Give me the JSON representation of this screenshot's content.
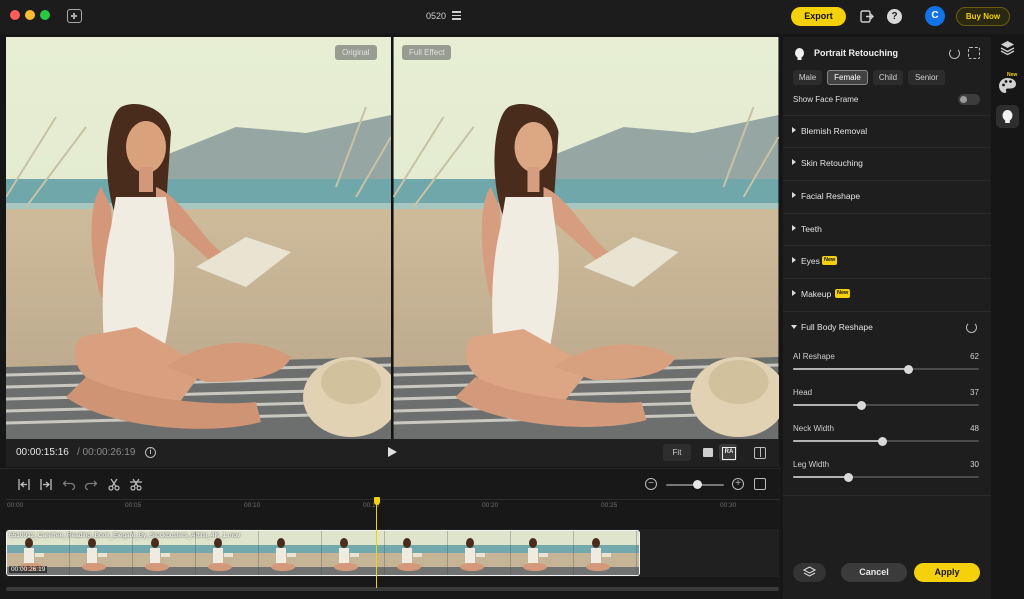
{
  "titlebar": {
    "project_name": "0520",
    "export_label": "Export",
    "avatar_letter": "C",
    "buy_now_label": "Buy Now",
    "help_glyph": "?"
  },
  "preview": {
    "original_label": "Original",
    "full_effect_label": "Full Effect"
  },
  "playback": {
    "current_time": "00:00:15:16",
    "total_time": "/ 00:00:26:19",
    "fit_label": "Fit",
    "info_glyph": "i"
  },
  "timeline": {
    "ruler_ticks": [
      "00:00",
      "00:05",
      "00:10",
      "00:15",
      "00:20",
      "00:25",
      "00:30"
    ],
    "clip_name": "6510912_Carefree_Reading_Book_Elegant_By_Stockbusters_Artlist_4K_1.mov",
    "clip_duration": "00:00:26:19",
    "playhead_time_s": 15.5,
    "zoom_level": 0.5
  },
  "panel": {
    "title": "Portrait Retouching",
    "gender_options": [
      "Male",
      "Female",
      "Child",
      "Senior"
    ],
    "gender_selected": "Female",
    "show_face_frame_label": "Show Face Frame",
    "show_face_frame_on": false,
    "new_badge": "New",
    "sections": [
      {
        "label": "Blemish Removal",
        "new": false,
        "open": false
      },
      {
        "label": "Skin Retouching",
        "new": false,
        "open": false
      },
      {
        "label": "Facial Reshape",
        "new": false,
        "open": false
      },
      {
        "label": "Teeth",
        "new": false,
        "open": false
      },
      {
        "label": "Eyes",
        "new": true,
        "open": false
      },
      {
        "label": "Makeup",
        "new": true,
        "open": false
      },
      {
        "label": "Full Body Reshape",
        "new": false,
        "open": true
      }
    ],
    "sliders": [
      {
        "label": "AI Reshape",
        "value": "62",
        "level": 0.62
      },
      {
        "label": "Head",
        "value": "37",
        "level": 0.37
      },
      {
        "label": "Neck Width",
        "value": "48",
        "level": 0.48
      },
      {
        "label": "Leg Width",
        "value": "30",
        "level": 0.3
      }
    ],
    "cancel_label": "Cancel",
    "apply_label": "Apply"
  },
  "right_toolbar": {
    "new_badge": "New"
  },
  "colors": {
    "accent": "#f5d10b",
    "avatar": "#1273e6",
    "panel_bg": "#1e1e1e"
  }
}
